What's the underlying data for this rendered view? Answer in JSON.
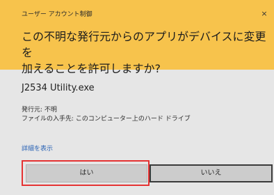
{
  "window": {
    "title": "ユーザー アカウント制御",
    "close_glyph": "×"
  },
  "prompt": {
    "question": "この不明な発行元からのアプリがデバイスに変更を\n加えることを許可しますか?"
  },
  "app": {
    "name": "J2534 Utility.exe",
    "publisher_line": "発行元: 不明",
    "origin_line": "ファイルの入手先: このコンピューター上のハード ドライブ"
  },
  "links": {
    "show_details": "詳細を表示"
  },
  "buttons": {
    "yes_label": "はい",
    "no_label": "いいえ"
  },
  "colors": {
    "header_bg": "#f7c34c",
    "body_bg": "#e6e6e6",
    "link": "#2a63b5",
    "highlight": "#e53232"
  }
}
